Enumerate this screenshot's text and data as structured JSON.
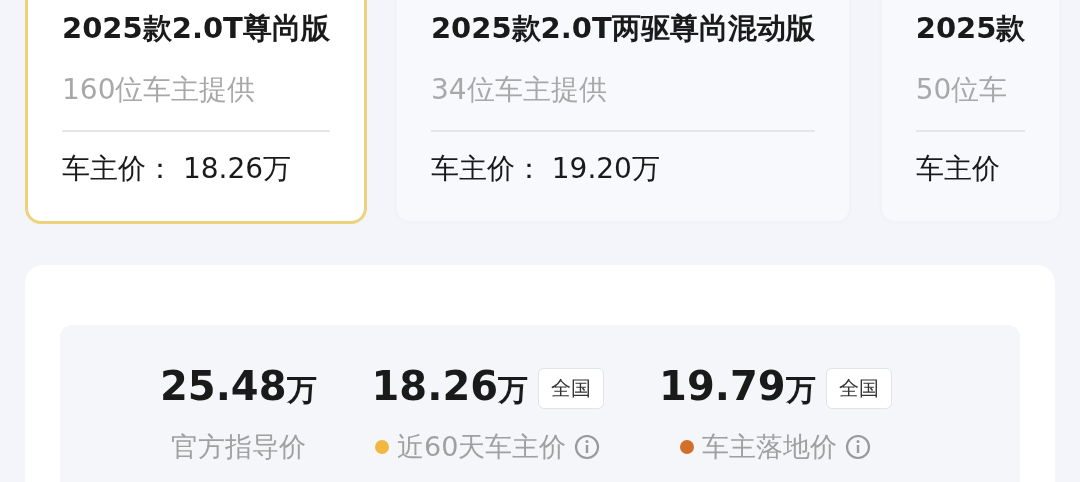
{
  "model_cards": [
    {
      "title": "2025款2.0T尊尚版",
      "owners": "160位车主提供",
      "price_label": "车主价：",
      "price": "18.26万",
      "selected": true
    },
    {
      "title": "2025款2.0T两驱尊尚混动版",
      "owners": "34位车主提供",
      "price_label": "车主价：",
      "price": "19.20万",
      "selected": false
    },
    {
      "title": "2025款",
      "owners": "50位车",
      "price_label": "车主价",
      "selected": false
    }
  ],
  "price_summary": [
    {
      "value": "25.48",
      "unit": "万",
      "label": "官方指导价"
    },
    {
      "value": "18.26",
      "unit": "万",
      "region": "全国",
      "label": "近60天车主价",
      "color": "#f0b840",
      "info": true
    },
    {
      "value": "19.79",
      "unit": "万",
      "region": "全国",
      "label": "车主落地价",
      "color": "#d0702a",
      "info": true
    }
  ]
}
